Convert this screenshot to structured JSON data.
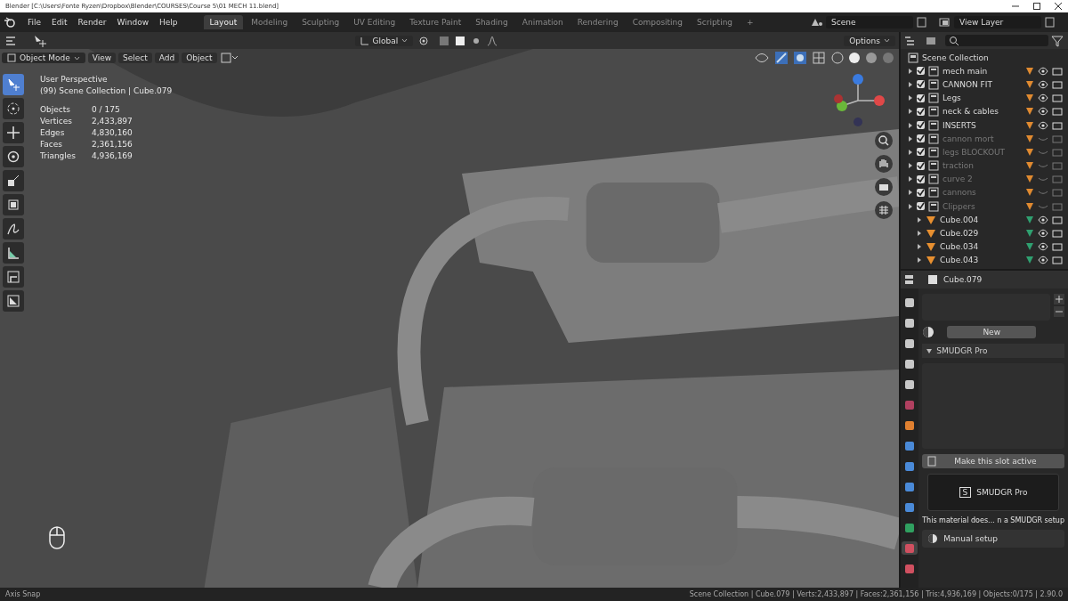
{
  "window": {
    "title": "Blender [C:\\Users\\Fonte Ryzen\\Dropbox\\Blender\\COURSES\\Course 5\\01 MECH 11.blend]"
  },
  "menu": [
    "File",
    "Edit",
    "Render",
    "Window",
    "Help"
  ],
  "workspaces": [
    {
      "label": "Layout",
      "selected": true
    },
    {
      "label": "Modeling",
      "selected": false
    },
    {
      "label": "Sculpting",
      "selected": false
    },
    {
      "label": "UV Editing",
      "selected": false
    },
    {
      "label": "Texture Paint",
      "selected": false
    },
    {
      "label": "Shading",
      "selected": false
    },
    {
      "label": "Animation",
      "selected": false
    },
    {
      "label": "Rendering",
      "selected": false
    },
    {
      "label": "Compositing",
      "selected": false
    },
    {
      "label": "Scripting",
      "selected": false
    }
  ],
  "add_workspace": "+",
  "scene": "Scene",
  "view_layer": "View Layer",
  "tool_header": {
    "orientation": "Global",
    "options": "Options"
  },
  "viewport_header": {
    "mode": "Object Mode",
    "menus": [
      "View",
      "Select",
      "Add",
      "Object"
    ]
  },
  "tools": [
    {
      "kind": "select",
      "selected": true
    },
    {
      "kind": "cursor",
      "selected": false
    },
    {
      "kind": "move",
      "selected": false
    },
    {
      "kind": "rotate",
      "selected": false
    },
    {
      "kind": "scale",
      "selected": false
    },
    {
      "kind": "transform",
      "selected": false
    },
    {
      "kind": "annotate",
      "selected": false
    },
    {
      "kind": "measure",
      "selected": false
    },
    {
      "kind": "shear",
      "selected": false
    },
    {
      "kind": "image",
      "selected": false
    }
  ],
  "overlay": {
    "view": "User Perspective",
    "context": "(99) Scene Collection | Cube.079",
    "stats": [
      {
        "label": "Objects",
        "value": "0 / 175"
      },
      {
        "label": "Vertices",
        "value": "2,433,897"
      },
      {
        "label": "Edges",
        "value": "4,830,160"
      },
      {
        "label": "Faces",
        "value": "2,361,156"
      },
      {
        "label": "Triangles",
        "value": "4,936,169"
      }
    ]
  },
  "outliner": {
    "root": "Scene Collection",
    "items": [
      {
        "kind": "collection",
        "name": "mech main",
        "checked": true,
        "visible": true
      },
      {
        "kind": "collection",
        "name": "CANNON FIT",
        "checked": true,
        "visible": true
      },
      {
        "kind": "collection",
        "name": "Legs",
        "checked": true,
        "visible": true
      },
      {
        "kind": "collection",
        "name": "neck & cables",
        "checked": true,
        "visible": true
      },
      {
        "kind": "collection",
        "name": "INSERTS",
        "checked": true,
        "visible": true
      },
      {
        "kind": "collection",
        "name": "cannon mort",
        "checked": true,
        "visible": false
      },
      {
        "kind": "collection",
        "name": "legs BLOCKOUT",
        "checked": true,
        "visible": false
      },
      {
        "kind": "collection",
        "name": "traction",
        "checked": true,
        "visible": false
      },
      {
        "kind": "collection",
        "name": "curve 2",
        "checked": true,
        "visible": false
      },
      {
        "kind": "collection",
        "name": "cannons",
        "checked": true,
        "visible": false
      },
      {
        "kind": "collection",
        "name": "Clippers",
        "checked": true,
        "visible": false,
        "children": [
          {
            "kind": "object",
            "name": "Cube.004",
            "visible": true
          },
          {
            "kind": "object",
            "name": "Cube.029",
            "visible": true
          },
          {
            "kind": "object",
            "name": "Cube.034",
            "visible": true
          },
          {
            "kind": "object",
            "name": "Cube.043",
            "visible": true
          }
        ]
      }
    ]
  },
  "properties": {
    "object": "Cube.079",
    "tabs": [
      {
        "color": "#c8c8c8",
        "selected": false
      },
      {
        "color": "#c8c8c8",
        "selected": false
      },
      {
        "color": "#c8c8c8",
        "selected": false
      },
      {
        "color": "#c8c8c8",
        "selected": false
      },
      {
        "color": "#c8c8c8",
        "selected": false
      },
      {
        "color": "#b04060",
        "selected": false
      },
      {
        "color": "#e08030",
        "selected": false
      },
      {
        "color": "#4a8ad8",
        "selected": false
      },
      {
        "color": "#4a8ad8",
        "selected": false
      },
      {
        "color": "#4a8ad8",
        "selected": false
      },
      {
        "color": "#4a8ad8",
        "selected": false
      },
      {
        "color": "#30a060",
        "selected": false
      },
      {
        "color": "#d05060",
        "selected": true
      },
      {
        "color": "#d05060",
        "selected": false
      }
    ],
    "new_button": "New",
    "panel_title": "SMUDGR Pro",
    "slot_button": "Make this slot active",
    "addon_button": "SMUDGR Pro",
    "addon_letter": "S",
    "message": "This material does... n a SMUDGR setup",
    "manual_button": "Manual setup"
  },
  "status_bar": {
    "left": "Axis Snap",
    "right": "Scene Collection | Cube.079 | Verts:2,433,897 | Faces:2,361,156 | Tris:4,936,169 | Objects:0/175 | 2.90.0"
  }
}
